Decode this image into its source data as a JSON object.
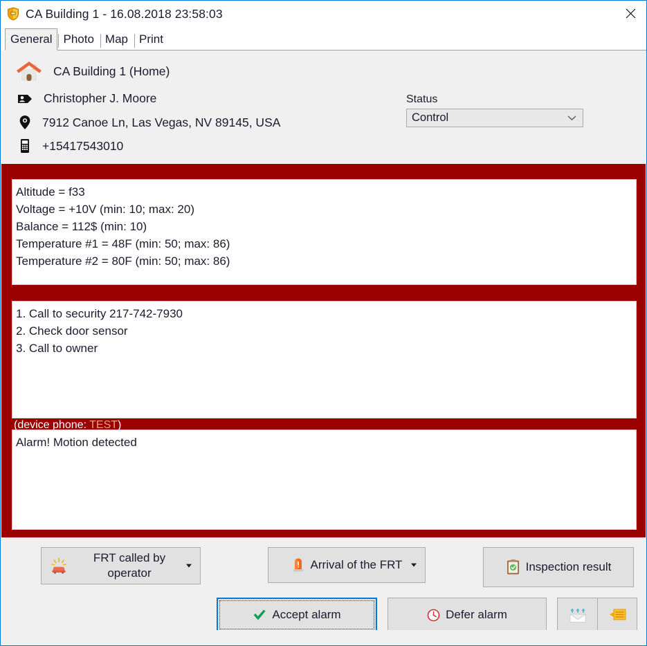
{
  "window": {
    "title": "CA Building 1 - 16.08.2018 23:58:03",
    "icon": "shield-icon",
    "close_label": "close-icon"
  },
  "tabs": [
    {
      "label": "General",
      "active": true
    },
    {
      "label": "Photo",
      "active": false
    },
    {
      "label": "Map",
      "active": false
    },
    {
      "label": "Print",
      "active": false
    }
  ],
  "info": {
    "object_name": "CA Building 1 (Home)",
    "object_icon": "house-icon",
    "contact_name": "Christopher J. Moore",
    "contact_icon": "contact-card-icon",
    "address": "7912 Canoe Ln, Las Vegas, NV 89145, USA",
    "address_icon": "location-pin-icon",
    "phone": "+15417543010",
    "phone_icon": "mobile-phone-icon"
  },
  "status": {
    "label": "Status",
    "value": "Control",
    "arrow_icon": "chevron-down-icon"
  },
  "data_panel": {
    "lines": [
      "Altitude = f33",
      "Voltage = +10V (min: 10; max: 20)",
      "Balance = 112$ (min: 10)",
      "Temperature #1 = 48F (min: 50; max: 86)",
      "Temperature #2 = 80F (min: 50; max: 86)"
    ]
  },
  "instructions_panel": {
    "lines": [
      "1. Call to security 217-742-7930",
      "2. Check door sensor",
      "3. Call to owner"
    ]
  },
  "device_phone": {
    "prefix": "(device phone: ",
    "value": "TEST",
    "suffix": ")"
  },
  "message_panel": {
    "lines": [
      "Alarm! Motion detected"
    ]
  },
  "actions": {
    "frt_called": {
      "label_line1": "FRT called by",
      "label_line2": "operator",
      "icon": "emergency-car-icon",
      "has_dropdown": true
    },
    "arrival": {
      "label": "Arrival of the FRT",
      "icon": "alarm-beacon-icon",
      "has_dropdown": true
    },
    "inspection": {
      "label": "Inspection result",
      "icon": "clipboard-check-icon"
    },
    "accept": {
      "label": "Accept alarm",
      "icon": "green-check-icon"
    },
    "defer": {
      "label": "Defer alarm",
      "icon": "red-clock-icon"
    },
    "send_mail": {
      "icon": "send-mail-icon"
    },
    "note": {
      "icon": "orange-note-icon"
    }
  },
  "colors": {
    "alarm_red": "#9b0000",
    "accent_blue": "#0078d7",
    "window_bg": "#f0f0f0",
    "panel_white": "#ffffff"
  }
}
